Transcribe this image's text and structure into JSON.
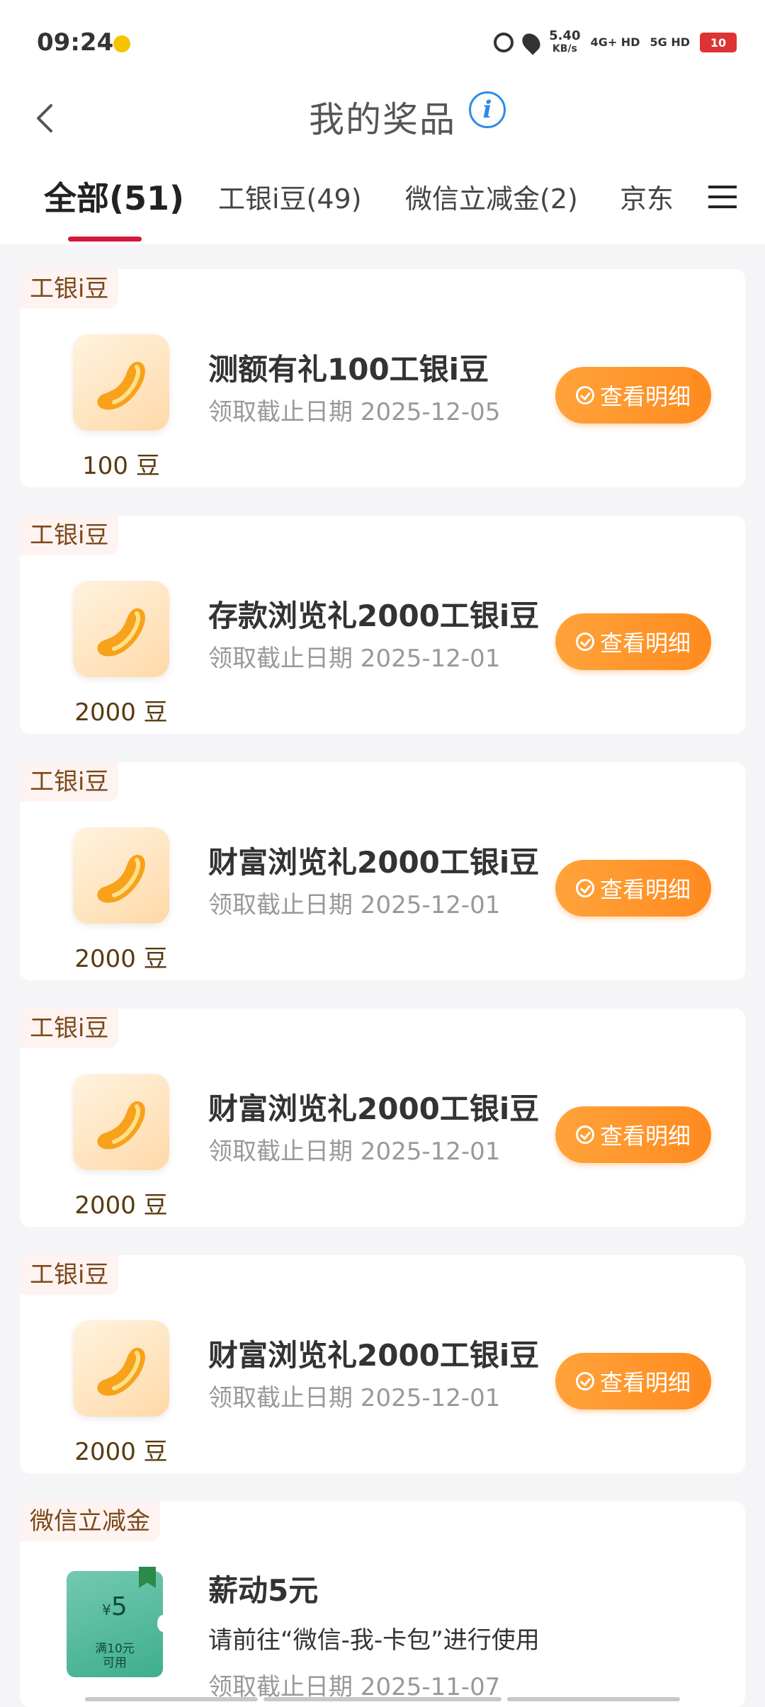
{
  "status_bar": {
    "time": "09:24",
    "net_speed_value": "5.40",
    "net_speed_unit": "KB/s",
    "sig1": "4G+ HD",
    "sig2": "5G HD",
    "battery": "10"
  },
  "header": {
    "title": "我的奖品",
    "info_glyph": "i"
  },
  "tabs": [
    {
      "label": "全部(51)",
      "active": true
    },
    {
      "label": "工银i豆(49)",
      "active": false
    },
    {
      "label": "微信立减金(2)",
      "active": false
    },
    {
      "label": "京东",
      "active": false
    }
  ],
  "prizes": [
    {
      "tag": "工银i豆",
      "name": "测额有礼100工银i豆",
      "deadline": "领取截止日期 2025-12-05",
      "amount": "100 豆",
      "button": "查看明细"
    },
    {
      "tag": "工银i豆",
      "name": "存款浏览礼2000工银i豆",
      "deadline": "领取截止日期 2025-12-01",
      "amount": "2000 豆",
      "button": "查看明细"
    },
    {
      "tag": "工银i豆",
      "name": "财富浏览礼2000工银i豆",
      "deadline": "领取截止日期 2025-12-01",
      "amount": "2000 豆",
      "button": "查看明细"
    },
    {
      "tag": "工银i豆",
      "name": "财富浏览礼2000工银i豆",
      "deadline": "领取截止日期 2025-12-01",
      "amount": "2000 豆",
      "button": "查看明细"
    },
    {
      "tag": "工银i豆",
      "name": "财富浏览礼2000工银i豆",
      "deadline": "领取截止日期 2025-12-01",
      "amount": "2000 豆",
      "button": "查看明细"
    }
  ],
  "wechat": {
    "tag": "微信立减金",
    "name": "薪动5元",
    "desc": "请前往“微信-我-卡包”进行使用",
    "deadline": "领取截止日期 2025-11-07",
    "coupon_currency": "¥",
    "coupon_value": "5",
    "coupon_cond_1": "满10元",
    "coupon_cond_2": "可用"
  },
  "colors": {
    "accent_red": "#d2193b",
    "button_orange": "#ff8a1f",
    "info_blue": "#2c8be8"
  }
}
